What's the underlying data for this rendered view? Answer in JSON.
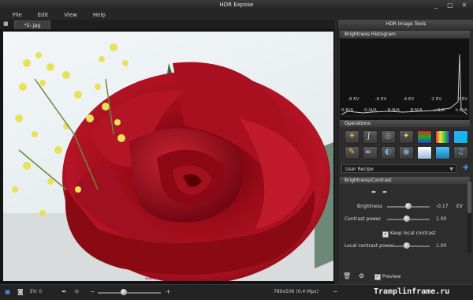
{
  "window": {
    "title": "HDR Expose",
    "controls": [
      "_",
      "□",
      "✕"
    ]
  },
  "menu": [
    "File",
    "Edit",
    "View",
    "Help"
  ],
  "tab": {
    "label": "*2-.jpg"
  },
  "watermark": "www.wallpaperz.com",
  "panel": {
    "title": "HDR Image Tools",
    "histogram_title": "Brightness Histogram",
    "ev_labels": [
      "-8 EV",
      "-6 EV",
      "-4 EV",
      "-2 EV",
      "0 EV"
    ],
    "channel_labels": [
      "R:N/A",
      "G:N/A",
      "B:N/A",
      "B:N/A",
      "c:N/A",
      "h:N/A"
    ],
    "operations_title": "Operations",
    "recipe": "User Recipe",
    "bc_title": "Brightness/Contrast",
    "brightness_label": "Brightness",
    "brightness_value": "-0.17",
    "brightness_unit": "EV",
    "brightness_level": 0.5,
    "contrast_label": "Contrast power",
    "contrast_value": "1.00",
    "contrast_level": 0.45,
    "keep_local": "Keep local contrast",
    "keep_local_checked": true,
    "local_label": "Local contrast power",
    "local_value": "1.00",
    "local_level": 0.45,
    "preview": "Preview",
    "preview_checked": true
  },
  "status": {
    "ev": "EV: 0",
    "dims": "789x506 (0.4 Mpx)",
    "zoom_level": 0.4
  },
  "site": "Tramplinframe.ru",
  "colors": {
    "accent": "#4a90e2",
    "rose": "#a0101c"
  }
}
